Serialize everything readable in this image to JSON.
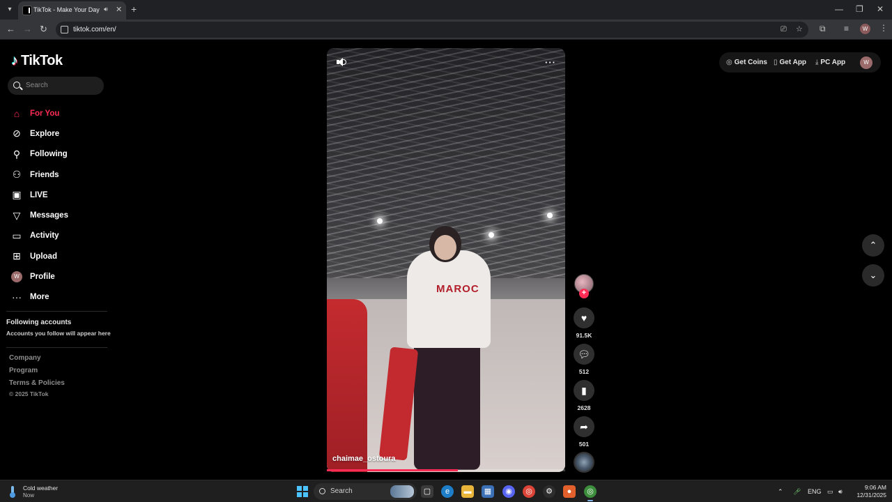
{
  "browser": {
    "tab_title": "TikTok - Make Your Day",
    "url": "tiktok.com/en/"
  },
  "sidebar": {
    "logo_text": "TikTok",
    "search_placeholder": "Search",
    "nav": [
      {
        "label": "For You",
        "icon": "home-icon",
        "active": true
      },
      {
        "label": "Explore",
        "icon": "compass-icon"
      },
      {
        "label": "Following",
        "icon": "following-icon"
      },
      {
        "label": "Friends",
        "icon": "friends-icon"
      },
      {
        "label": "LIVE",
        "icon": "live-icon"
      },
      {
        "label": "Messages",
        "icon": "messages-icon"
      },
      {
        "label": "Activity",
        "icon": "activity-icon"
      },
      {
        "label": "Upload",
        "icon": "upload-icon"
      },
      {
        "label": "Profile",
        "icon": "avatar"
      },
      {
        "label": "More",
        "icon": "more-icon"
      }
    ],
    "profile_initial": "W",
    "following_title": "Following accounts",
    "following_sub": "Accounts you follow will appear here",
    "footer": [
      "Company",
      "Program",
      "Terms & Policies"
    ],
    "copyright": "© 2025 TikTok"
  },
  "video": {
    "author": "chaimae_ostoura",
    "sweater_text": "MAROC",
    "progress_fraction": 0.55,
    "likes": "91.5K",
    "comments": "512",
    "saves": "2628",
    "shares": "501"
  },
  "header": {
    "get_coins": "Get Coins",
    "get_app": "Get App",
    "pc_app": "PC App",
    "avatar_initial": "W"
  },
  "taskbar": {
    "weather_title": "Cold weather",
    "weather_sub": "Now",
    "search_label": "Search",
    "lang": "ENG",
    "time": "9:06 AM",
    "date": "12/31/2025"
  },
  "colors": {
    "accent": "#fe2c55",
    "background": "#000000"
  }
}
